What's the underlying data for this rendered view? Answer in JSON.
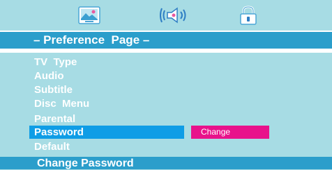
{
  "top_tabs": [
    {
      "icon": "video-settings-icon"
    },
    {
      "icon": "audio-speaker-icon"
    },
    {
      "icon": "lock-icon"
    }
  ],
  "header": {
    "title": "– Preference  Page –"
  },
  "menu": {
    "items": [
      {
        "label": "TV  Type"
      },
      {
        "label": "Audio"
      },
      {
        "label": "Subtitle"
      },
      {
        "label": "Disc  Menu"
      },
      {
        "label": "Parental"
      },
      {
        "label": "Password",
        "selected": true
      },
      {
        "label": "Default"
      }
    ]
  },
  "option": {
    "value": "Change"
  },
  "footer": {
    "text": "Change Password"
  },
  "colors": {
    "background": "#a7dce4",
    "header": "#2b9ecb",
    "selected": "#0f9de6",
    "option": "#e8128b",
    "text": "#ffffff"
  }
}
